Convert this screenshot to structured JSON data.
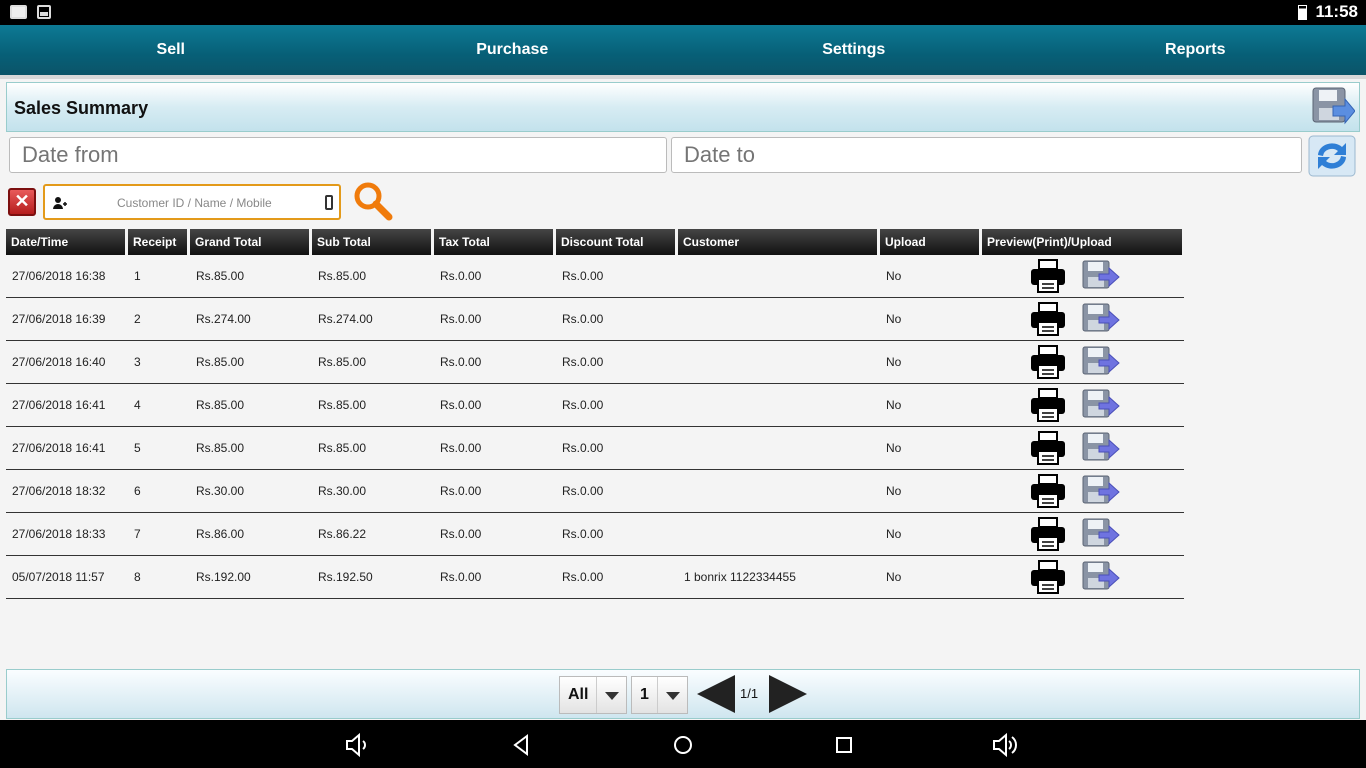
{
  "status": {
    "time": "11:58"
  },
  "nav": {
    "items": [
      "Sell",
      "Purchase",
      "Settings",
      "Reports"
    ]
  },
  "page": {
    "title": "Sales Summary"
  },
  "filters": {
    "date_from_placeholder": "Date from",
    "date_to_placeholder": "Date to",
    "customer_placeholder": "Customer ID / Name / Mobile"
  },
  "table": {
    "headers": [
      "Date/Time",
      "Receipt",
      "Grand Total",
      "Sub Total",
      "Tax Total",
      "Discount Total",
      "Customer",
      "Upload",
      "Preview(Print)/Upload"
    ],
    "rows": [
      [
        "27/06/2018 16:38",
        "1",
        "Rs.85.00",
        "Rs.85.00",
        "Rs.0.00",
        "Rs.0.00",
        "",
        "No"
      ],
      [
        "27/06/2018 16:39",
        "2",
        "Rs.274.00",
        "Rs.274.00",
        "Rs.0.00",
        "Rs.0.00",
        "",
        "No"
      ],
      [
        "27/06/2018 16:40",
        "3",
        "Rs.85.00",
        "Rs.85.00",
        "Rs.0.00",
        "Rs.0.00",
        "",
        "No"
      ],
      [
        "27/06/2018 16:41",
        "4",
        "Rs.85.00",
        "Rs.85.00",
        "Rs.0.00",
        "Rs.0.00",
        "",
        "No"
      ],
      [
        "27/06/2018 16:41",
        "5",
        "Rs.85.00",
        "Rs.85.00",
        "Rs.0.00",
        "Rs.0.00",
        "",
        "No"
      ],
      [
        "27/06/2018 18:32",
        "6",
        "Rs.30.00",
        "Rs.30.00",
        "Rs.0.00",
        "Rs.0.00",
        "",
        "No"
      ],
      [
        "27/06/2018 18:33",
        "7",
        "Rs.86.00",
        "Rs.86.22",
        "Rs.0.00",
        "Rs.0.00",
        "",
        "No"
      ],
      [
        "05/07/2018 11:57",
        "8",
        "Rs.192.00",
        "Rs.192.50",
        "Rs.0.00",
        "Rs.0.00",
        "1 bonrix 1122334455",
        "No"
      ]
    ]
  },
  "pager": {
    "filter_value": "All",
    "page_value": "1",
    "page_info": "1/1"
  },
  "icons": {
    "printer": "printer-icon",
    "upload": "floppy-arrow-upload-icon",
    "search": "magnifier-icon",
    "refresh": "refresh-icon",
    "clear": "close-icon"
  }
}
